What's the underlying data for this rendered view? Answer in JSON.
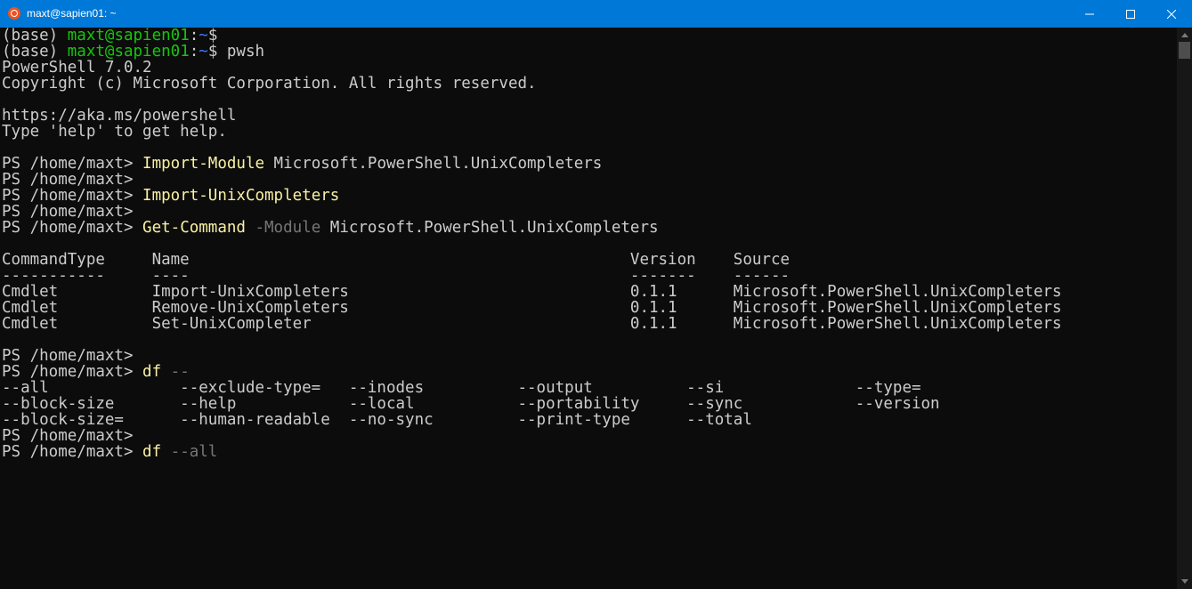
{
  "window": {
    "title": "maxt@sapien01: ~",
    "icon": "ubuntu-icon",
    "controls": [
      "minimize-icon",
      "maximize-icon",
      "close-icon"
    ]
  },
  "colors": {
    "titlebar": "#0078d7",
    "background": "#0c0c0c",
    "default": "#cccccc",
    "prompt_green": "#16c60c",
    "path_blue": "#3b78ff",
    "command_yellow": "#f9f1a5",
    "param_gray": "#767676"
  },
  "terminal": {
    "lines": [
      [
        {
          "t": "(base) ",
          "c": "default"
        },
        {
          "t": "maxt@sapien01",
          "c": "prompt_green"
        },
        {
          "t": ":",
          "c": "default"
        },
        {
          "t": "~",
          "c": "path_blue"
        },
        {
          "t": "$",
          "c": "default"
        }
      ],
      [
        {
          "t": "(base) ",
          "c": "default"
        },
        {
          "t": "maxt@sapien01",
          "c": "prompt_green"
        },
        {
          "t": ":",
          "c": "default"
        },
        {
          "t": "~",
          "c": "path_blue"
        },
        {
          "t": "$ pwsh",
          "c": "default"
        }
      ],
      [
        {
          "t": "PowerShell 7.0.2",
          "c": "default"
        }
      ],
      [
        {
          "t": "Copyright (c) Microsoft Corporation. All rights reserved.",
          "c": "default"
        }
      ],
      [
        {
          "t": "",
          "c": "default"
        }
      ],
      [
        {
          "t": "https://aka.ms/powershell",
          "c": "default"
        }
      ],
      [
        {
          "t": "Type 'help' to get help.",
          "c": "default"
        }
      ],
      [
        {
          "t": "",
          "c": "default"
        }
      ],
      [
        {
          "t": "PS /home/maxt> ",
          "c": "default"
        },
        {
          "t": "Import-Module",
          "c": "command_yellow"
        },
        {
          "t": " Microsoft.PowerShell.UnixCompleters",
          "c": "default"
        }
      ],
      [
        {
          "t": "PS /home/maxt>",
          "c": "default"
        }
      ],
      [
        {
          "t": "PS /home/maxt> ",
          "c": "default"
        },
        {
          "t": "Import-UnixCompleters",
          "c": "command_yellow"
        }
      ],
      [
        {
          "t": "PS /home/maxt>",
          "c": "default"
        }
      ],
      [
        {
          "t": "PS /home/maxt> ",
          "c": "default"
        },
        {
          "t": "Get-Command",
          "c": "command_yellow"
        },
        {
          "t": " -Module",
          "c": "param_gray"
        },
        {
          "t": " Microsoft.PowerShell.UnixCompleters",
          "c": "default"
        }
      ],
      [
        {
          "t": "",
          "c": "default"
        }
      ],
      [
        {
          "t": "CommandType     Name                                               Version    Source",
          "c": "default"
        }
      ],
      [
        {
          "t": "-----------     ----                                               -------    ------",
          "c": "default"
        }
      ],
      [
        {
          "t": "Cmdlet          Import-UnixCompleters                              0.1.1      Microsoft.PowerShell.UnixCompleters",
          "c": "default"
        }
      ],
      [
        {
          "t": "Cmdlet          Remove-UnixCompleters                              0.1.1      Microsoft.PowerShell.UnixCompleters",
          "c": "default"
        }
      ],
      [
        {
          "t": "Cmdlet          Set-UnixCompleter                                  0.1.1      Microsoft.PowerShell.UnixCompleters",
          "c": "default"
        }
      ],
      [
        {
          "t": "",
          "c": "default"
        }
      ],
      [
        {
          "t": "PS /home/maxt>",
          "c": "default"
        }
      ],
      [
        {
          "t": "PS /home/maxt> ",
          "c": "default"
        },
        {
          "t": "df",
          "c": "command_yellow"
        },
        {
          "t": " --",
          "c": "param_gray"
        }
      ],
      [
        {
          "t": "--all              --exclude-type=   --inodes          --output          --si              --type=",
          "c": "default"
        }
      ],
      [
        {
          "t": "--block-size       --help            --local           --portability     --sync            --version",
          "c": "default"
        }
      ],
      [
        {
          "t": "--block-size=      --human-readable  --no-sync         --print-type      --total",
          "c": "default"
        }
      ],
      [
        {
          "t": "PS /home/maxt>",
          "c": "default"
        }
      ],
      [
        {
          "t": "PS /home/maxt> ",
          "c": "default"
        },
        {
          "t": "df",
          "c": "command_yellow"
        },
        {
          "t": " --all",
          "c": "param_gray"
        }
      ]
    ]
  }
}
